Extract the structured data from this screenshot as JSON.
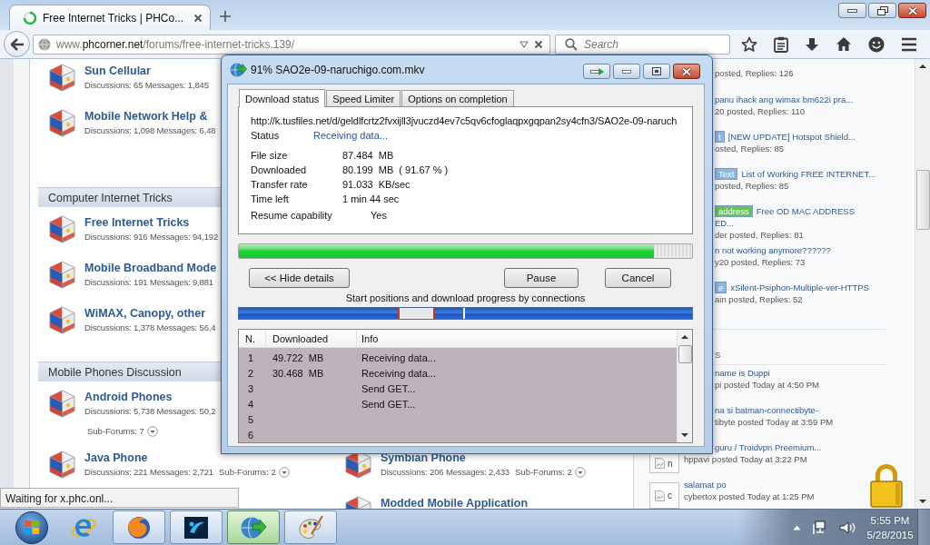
{
  "browser": {
    "tabs": [
      {
        "title": "Free Internet Tricks | PHCo...",
        "selected": true,
        "loading": true
      }
    ],
    "address_bar": {
      "url": "www.**phcorner.net**/forums/free-internet-tricks.139/"
    },
    "search": {
      "placeholder": "Search"
    }
  },
  "forum": {
    "sections": [
      {
        "rows": [
          {
            "left": {
              "title": "Sun Cellular",
              "stats": "Discussions: 65 Messages: 1,845"
            }
          },
          {
            "left": {
              "title": "Mobile Network Help &",
              "stats": "Discussions: 1,098 Messages: 6,48"
            }
          }
        ]
      },
      {
        "title": "Computer Internet Tricks",
        "rows": [
          {
            "left": {
              "title": "Free Internet Tricks",
              "stats": "Discussions: 916 Messages: 94,192"
            }
          },
          {
            "left": {
              "title": "Mobile Broadband Mode",
              "stats": "Discussions: 191 Messages: 9,881"
            }
          },
          {
            "left": {
              "title": "WiMAX, Canopy, other",
              "stats": "Discussions: 1,378 Messages: 56,4"
            }
          }
        ]
      },
      {
        "title": "Mobile Phones Discussion",
        "rows": [
          {
            "left": {
              "title": "Android Phones",
              "stats": "Discussions: 5,738 Messages: 50,2",
              "sub_forums": "Sub-Forums: 7"
            }
          },
          {
            "left": {
              "title": "Java Phone",
              "stats": "Discussions: 221 Messages: 2,721",
              "sub_forums": "Sub-Forums: 2"
            },
            "right": {
              "title": "Symbian Phone",
              "stats": "Discussions: 206 Messages: 2,433",
              "sub_forums": "Sub-Forums: 2"
            }
          },
          {
            "right": {
              "title": "Modded Mobile Application"
            }
          }
        ]
      }
    ]
  },
  "sidebar": {
    "threads": [
      {
        "meta": "posted, Replies: 126"
      },
      {
        "title": "panu ihack ang wimax bm622i pra...",
        "meta": "20 posted, Replies: 110"
      },
      {
        "prefix": {
          "text": "t",
          "color": "#8db6e2"
        },
        "title": "[NEW UPDATE] Hotspot Shield...",
        "meta": "osted, Replies: 85"
      },
      {
        "prefix": {
          "text": "Text",
          "color": "#8db6e2"
        },
        "title": "List of Working FREE INTERNET...",
        "meta": "posted, Replies: 85"
      },
      {
        "prefix": {
          "text": "address",
          "color": "#6cbf5e"
        },
        "title": "Free OD MAC ADDRESS",
        "title_wrap": "ED...",
        "meta": "der posted, Replies: 81"
      },
      {
        "title": "n not working anymore??????",
        "meta": "y20 posted, Replies: 73"
      },
      {
        "prefix": {
          "text": "e",
          "color": "#8db6e2"
        },
        "title": "xSilent-Psiphon-Multiple-ver-HTTPS",
        "meta": "ain posted, Replies: 52"
      }
    ],
    "heading": "S",
    "posts": [
      {
        "title": "name is Duppi",
        "meta": "pi posted Today at 4:50 PM"
      },
      {
        "title": "na si batman-connectibyte-",
        "meta": "tibyte posted Today at 3:59 PM"
      },
      {
        "title": "guru / Troidvpn Preemium...",
        "meta": "hppavi posted Today at 3:22 PM",
        "avatar": {
          "broken": true,
          "alt": "n"
        }
      },
      {
        "title": "salamat po",
        "meta": "cybertox posted Today at 1:25 PM",
        "avatar": {
          "broken": true,
          "alt": "c"
        }
      }
    ]
  },
  "status_tooltip": "Waiting for x.phc.onl...",
  "download_dialog": {
    "title": "91% SAO2e-09-naruchigo.com.mkv",
    "tabs": [
      {
        "label": "Download status",
        "selected": true
      },
      {
        "label": "Speed Limiter",
        "selected": false
      },
      {
        "label": "Options on completion",
        "selected": false
      }
    ],
    "url": "http://k.tusfiles.net/d/geldlfcrtz2fvxijll3jvuczd4ev7c5qv6cfoglaqpxgqpan2sy4cfn3/SAO2e-09-naruch",
    "status": {
      "label": "Status",
      "value": "Receiving data..."
    },
    "details": [
      {
        "label": "File size",
        "value": "87.484  MB"
      },
      {
        "label": "Downloaded",
        "value": "80.199  MB  ( 91.67 % )"
      },
      {
        "label": "Transfer rate",
        "value": "91.033  KB/sec"
      },
      {
        "label": "Time left",
        "value": "1 min 44 sec"
      }
    ],
    "resume": {
      "label": "Resume capability",
      "value": "Yes"
    },
    "progress": {
      "level": 0.9167
    },
    "buttons": [
      {
        "label": "<< Hide details"
      },
      {
        "label": "Pause"
      },
      {
        "label": "Cancel"
      }
    ],
    "connections": {
      "caption": "Start positions and download progress by connections",
      "columns": [
        "N.",
        "Downloaded",
        "Info"
      ],
      "rows": [
        {
          "n": "1",
          "downloaded": "49.722  MB",
          "info": "Receiving data..."
        },
        {
          "n": "2",
          "downloaded": "30.468  MB",
          "info": "Receiving data..."
        },
        {
          "n": "3",
          "info": "Send GET..."
        },
        {
          "n": "4",
          "info": "Send GET..."
        },
        {
          "n": "5"
        },
        {
          "n": "6"
        }
      ]
    }
  },
  "taskbar": {
    "apps": [
      {
        "kind": "ie",
        "running": false,
        "selected": false
      },
      {
        "kind": "firefox",
        "running": true,
        "selected": false
      },
      {
        "kind": "app",
        "running": true,
        "selected": false
      },
      {
        "kind": "idm",
        "running": true,
        "selected": true
      },
      {
        "kind": "paint",
        "running": true,
        "selected": false
      }
    ],
    "clock": {
      "time": "5:55 PM",
      "date": "5/28/2015"
    }
  }
}
